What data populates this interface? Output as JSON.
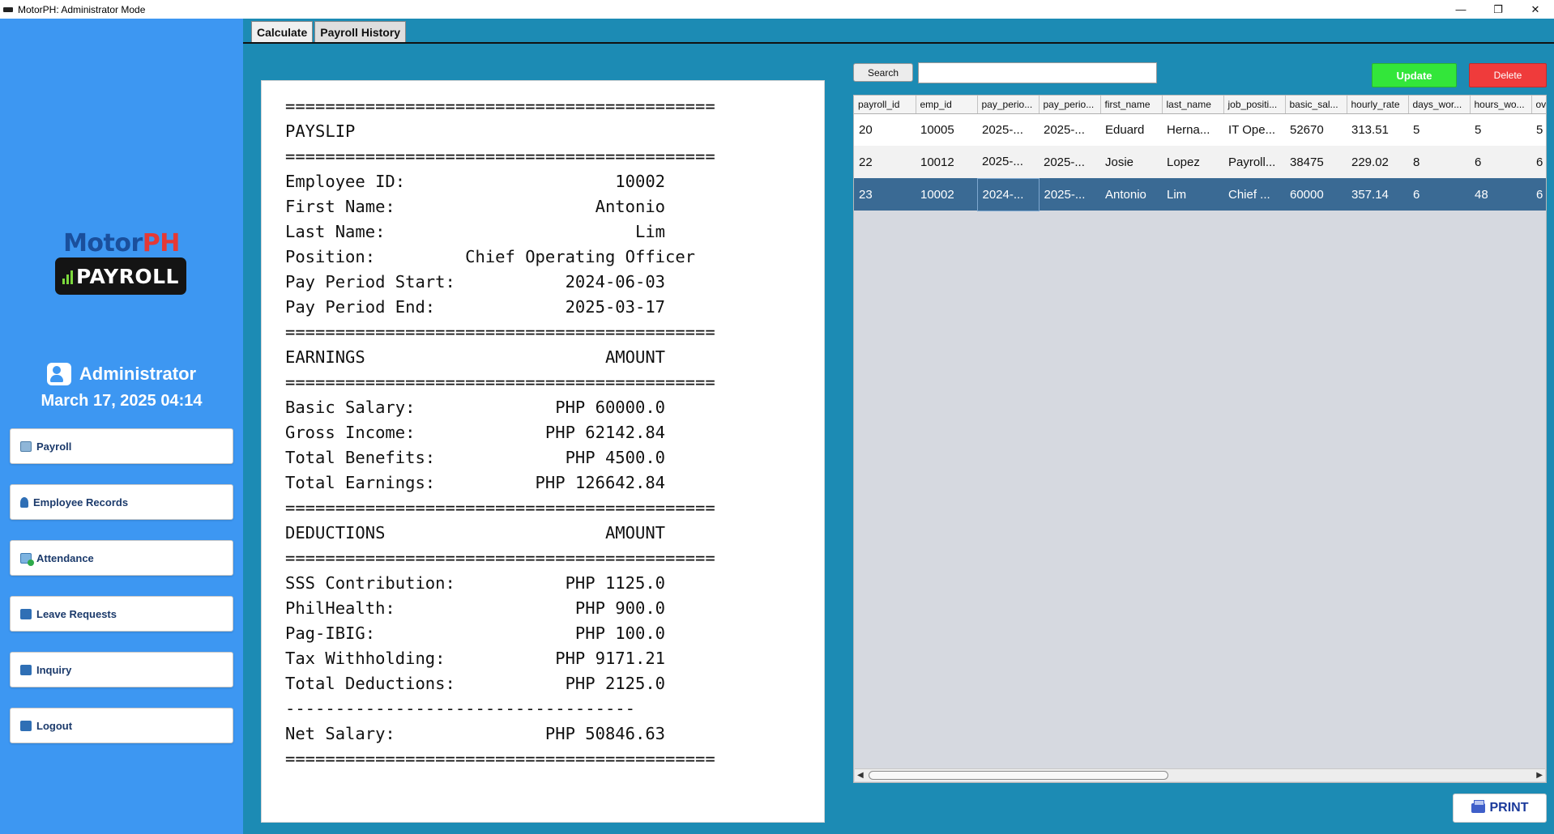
{
  "window": {
    "title": "MotorPH: Administrator Mode",
    "controls": {
      "minimize": "—",
      "restore": "❐",
      "close": "✕"
    }
  },
  "sidebar": {
    "logo": {
      "motor": "Motor",
      "ph": "PH",
      "badge": "PAYROLL"
    },
    "user": {
      "name": "Administrator",
      "datetime": "March 17, 2025 04:14"
    },
    "nav": [
      {
        "label": "Payroll",
        "icon": "payroll-icon"
      },
      {
        "label": "Employee Records",
        "icon": "employee-icon"
      },
      {
        "label": "Attendance",
        "icon": "attendance-icon"
      },
      {
        "label": "Leave Requests",
        "icon": "briefcase-icon"
      },
      {
        "label": "Inquiry",
        "icon": "mail-icon"
      },
      {
        "label": "Logout",
        "icon": "logout-icon"
      }
    ]
  },
  "tabs": [
    {
      "label": "Calculate",
      "active": false
    },
    {
      "label": "Payroll History",
      "active": true
    }
  ],
  "payslip": {
    "lines": [
      "===========================================",
      "PAYSLIP",
      "===========================================",
      "Employee ID:                     10002",
      "First Name:                    Antonio",
      "Last Name:                         Lim",
      "Position:         Chief Operating Officer",
      "Pay Period Start:           2024-06-03",
      "Pay Period End:             2025-03-17",
      "===========================================",
      "EARNINGS                        AMOUNT",
      "===========================================",
      "Basic Salary:              PHP 60000.0",
      "Gross Income:             PHP 62142.84",
      "Total Benefits:             PHP 4500.0",
      "Total Earnings:          PHP 126642.84",
      "===========================================",
      "DEDUCTIONS                      AMOUNT",
      "===========================================",
      "SSS Contribution:           PHP 1125.0",
      "PhilHealth:                  PHP 900.0",
      "Pag-IBIG:                    PHP 100.0",
      "Tax Withholding:           PHP 9171.21",
      "Total Deductions:           PHP 2125.0",
      "-----------------------------------",
      "Net Salary:               PHP 50846.63",
      "==========================================="
    ]
  },
  "toolbar": {
    "search_label": "Search",
    "search_value": "",
    "update_label": "Update",
    "delete_label": "Delete",
    "print_label": "PRINT"
  },
  "table": {
    "columns": [
      "payroll_id",
      "emp_id",
      "pay_perio...",
      "pay_perio...",
      "first_name",
      "last_name",
      "job_positi...",
      "basic_sal...",
      "hourly_rate",
      "days_wor...",
      "hours_wo...",
      "over"
    ],
    "rows": [
      [
        "20",
        "10005",
        "2025-...",
        "2025-...",
        "Eduard",
        "Herna...",
        "IT Ope...",
        "52670",
        "313.51",
        "5",
        "5",
        "5"
      ],
      [
        "22",
        "10012",
        "2025-...",
        "2025-...",
        "Josie",
        "Lopez",
        "Payroll...",
        "38475",
        "229.02",
        "8",
        "6",
        "6"
      ],
      [
        "23",
        "10002",
        "2024-...",
        "2025-...",
        "Antonio",
        "Lim",
        "Chief ...",
        "60000",
        "357.14",
        "6",
        "48",
        "6"
      ]
    ],
    "selected_row": 2
  },
  "colors": {
    "sidebar": "#3d97f2",
    "main": "#1c8bb4",
    "update": "#33e63a",
    "delete": "#ef3b3b",
    "selected_row": "#3a6a94"
  }
}
